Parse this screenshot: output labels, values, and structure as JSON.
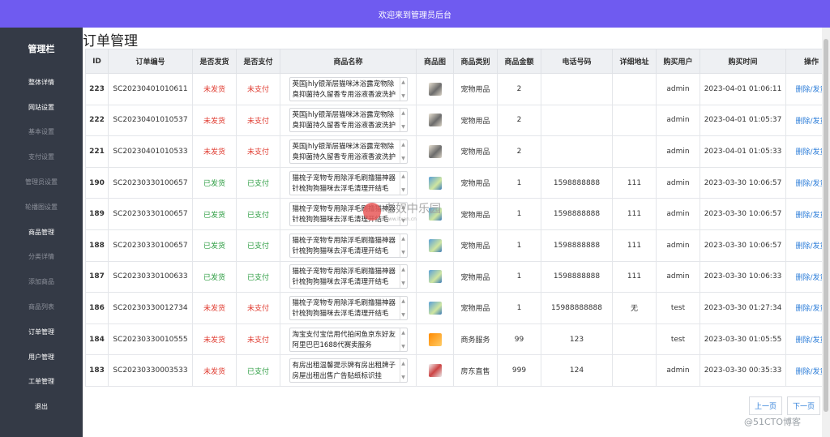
{
  "header": {
    "welcome": "欢迎来到管理员后台"
  },
  "sidebar": {
    "brand": "管理栏",
    "items": [
      {
        "label": "整体详情",
        "dim": false
      },
      {
        "label": "网站设置",
        "dim": false
      },
      {
        "label": "基本设置",
        "dim": true
      },
      {
        "label": "支付设置",
        "dim": true
      },
      {
        "label": "管理员设置",
        "dim": true
      },
      {
        "label": "轮播图设置",
        "dim": true
      },
      {
        "label": "商品管理",
        "dim": false
      },
      {
        "label": "分类详情",
        "dim": true
      },
      {
        "label": "添加商品",
        "dim": true
      },
      {
        "label": "商品列表",
        "dim": true
      },
      {
        "label": "订单管理",
        "dim": false
      },
      {
        "label": "用户管理",
        "dim": false
      },
      {
        "label": "工单管理",
        "dim": false
      },
      {
        "label": "退出",
        "dim": false
      }
    ]
  },
  "page": {
    "title": "订单管理"
  },
  "table": {
    "columns": [
      "ID",
      "订单编号",
      "是否发货",
      "是否支付",
      "商品名称",
      "商品图",
      "商品类别",
      "商品金额",
      "电话号码",
      "详细地址",
      "购买用户",
      "购买时间",
      "操作"
    ],
    "rows": [
      {
        "id": "223",
        "order_no": "SC20230401010611",
        "shipped": "未发货",
        "paid": "未支付",
        "name": "英国jhly银渐层猫咪沐浴露宠物除臭抑菌持久留香专用浴液香波洗护",
        "img": "pet",
        "category": "宠物用品",
        "amount": "2",
        "phone": "",
        "address": "",
        "user": "admin",
        "time": "2023-04-01 01:06:11"
      },
      {
        "id": "222",
        "order_no": "SC20230401010537",
        "shipped": "未发货",
        "paid": "未支付",
        "name": "英国jhly银渐层猫咪沐浴露宠物除臭抑菌持久留香专用浴液香波洗护",
        "img": "pet",
        "category": "宠物用品",
        "amount": "2",
        "phone": "",
        "address": "",
        "user": "admin",
        "time": "2023-04-01 01:05:37"
      },
      {
        "id": "221",
        "order_no": "SC20230401010533",
        "shipped": "未发货",
        "paid": "未支付",
        "name": "英国jhly银渐层猫咪沐浴露宠物除臭抑菌持久留香专用浴液香波洗护",
        "img": "pet",
        "category": "宠物用品",
        "amount": "2",
        "phone": "",
        "address": "",
        "user": "admin",
        "time": "2023-04-01 01:05:33"
      },
      {
        "id": "190",
        "order_no": "SC20230330100657",
        "shipped": "已发货",
        "paid": "已支付",
        "name": "猫梳子宠物专用除浮毛刷撸猫神器针梳狗狗猫咪去浮毛清理开结毛",
        "img": "comb",
        "category": "宠物用品",
        "amount": "1",
        "phone": "1598888888",
        "address": "111",
        "user": "admin",
        "time": "2023-03-30 10:06:57"
      },
      {
        "id": "189",
        "order_no": "SC20230330100657",
        "shipped": "已发货",
        "paid": "已支付",
        "name": "猫梳子宠物专用除浮毛刷撸猫神器针梳狗狗猫咪去浮毛清理开结毛",
        "img": "comb",
        "category": "宠物用品",
        "amount": "1",
        "phone": "1598888888",
        "address": "111",
        "user": "admin",
        "time": "2023-03-30 10:06:57"
      },
      {
        "id": "188",
        "order_no": "SC20230330100657",
        "shipped": "已发货",
        "paid": "已支付",
        "name": "猫梳子宠物专用除浮毛刷撸猫神器针梳狗狗猫咪去浮毛清理开结毛",
        "img": "comb",
        "category": "宠物用品",
        "amount": "1",
        "phone": "1598888888",
        "address": "111",
        "user": "admin",
        "time": "2023-03-30 10:06:57"
      },
      {
        "id": "187",
        "order_no": "SC20230330100633",
        "shipped": "已发货",
        "paid": "已支付",
        "name": "猫梳子宠物专用除浮毛刷撸猫神器针梳狗狗猫咪去浮毛清理开结毛",
        "img": "comb",
        "category": "宠物用品",
        "amount": "1",
        "phone": "1598888888",
        "address": "111",
        "user": "admin",
        "time": "2023-03-30 10:06:33"
      },
      {
        "id": "186",
        "order_no": "SC20230330012734",
        "shipped": "未发货",
        "paid": "未支付",
        "name": "猫梳子宠物专用除浮毛刷撸猫神器针梳狗狗猫咪去浮毛清理开结毛",
        "img": "comb",
        "category": "宠物用品",
        "amount": "1",
        "phone": "15988888888",
        "address": "无",
        "user": "test",
        "time": "2023-03-30 01:27:34"
      },
      {
        "id": "184",
        "order_no": "SC20230330010555",
        "shipped": "未发货",
        "paid": "未支付",
        "name": "淘宝支付宝信用代拍闲鱼京东好友阿里巴巴1688代赛卖服务",
        "img": "biz",
        "category": "商务服务",
        "amount": "99",
        "phone": "123",
        "address": "",
        "user": "test",
        "time": "2023-03-30 01:05:55"
      },
      {
        "id": "183",
        "order_no": "SC20230330003533",
        "shipped": "未发货",
        "paid": "已支付",
        "name": "有房出租温馨提示牌有房出租牌子房屋出租出售广告贴纸标识挂",
        "img": "house",
        "category": "房东直售",
        "amount": "999",
        "phone": "124",
        "address": "",
        "user": "admin",
        "time": "2023-03-30 00:35:33"
      }
    ],
    "op_delete": "删除",
    "op_sep": "/",
    "op_ship": "发货"
  },
  "pager": {
    "prev": "上一页",
    "next": "下一页"
  },
  "watermark": {
    "name": "老奴中乐园",
    "url": "www.itxen.cn"
  },
  "footer_mark": "@51CTO博客"
}
